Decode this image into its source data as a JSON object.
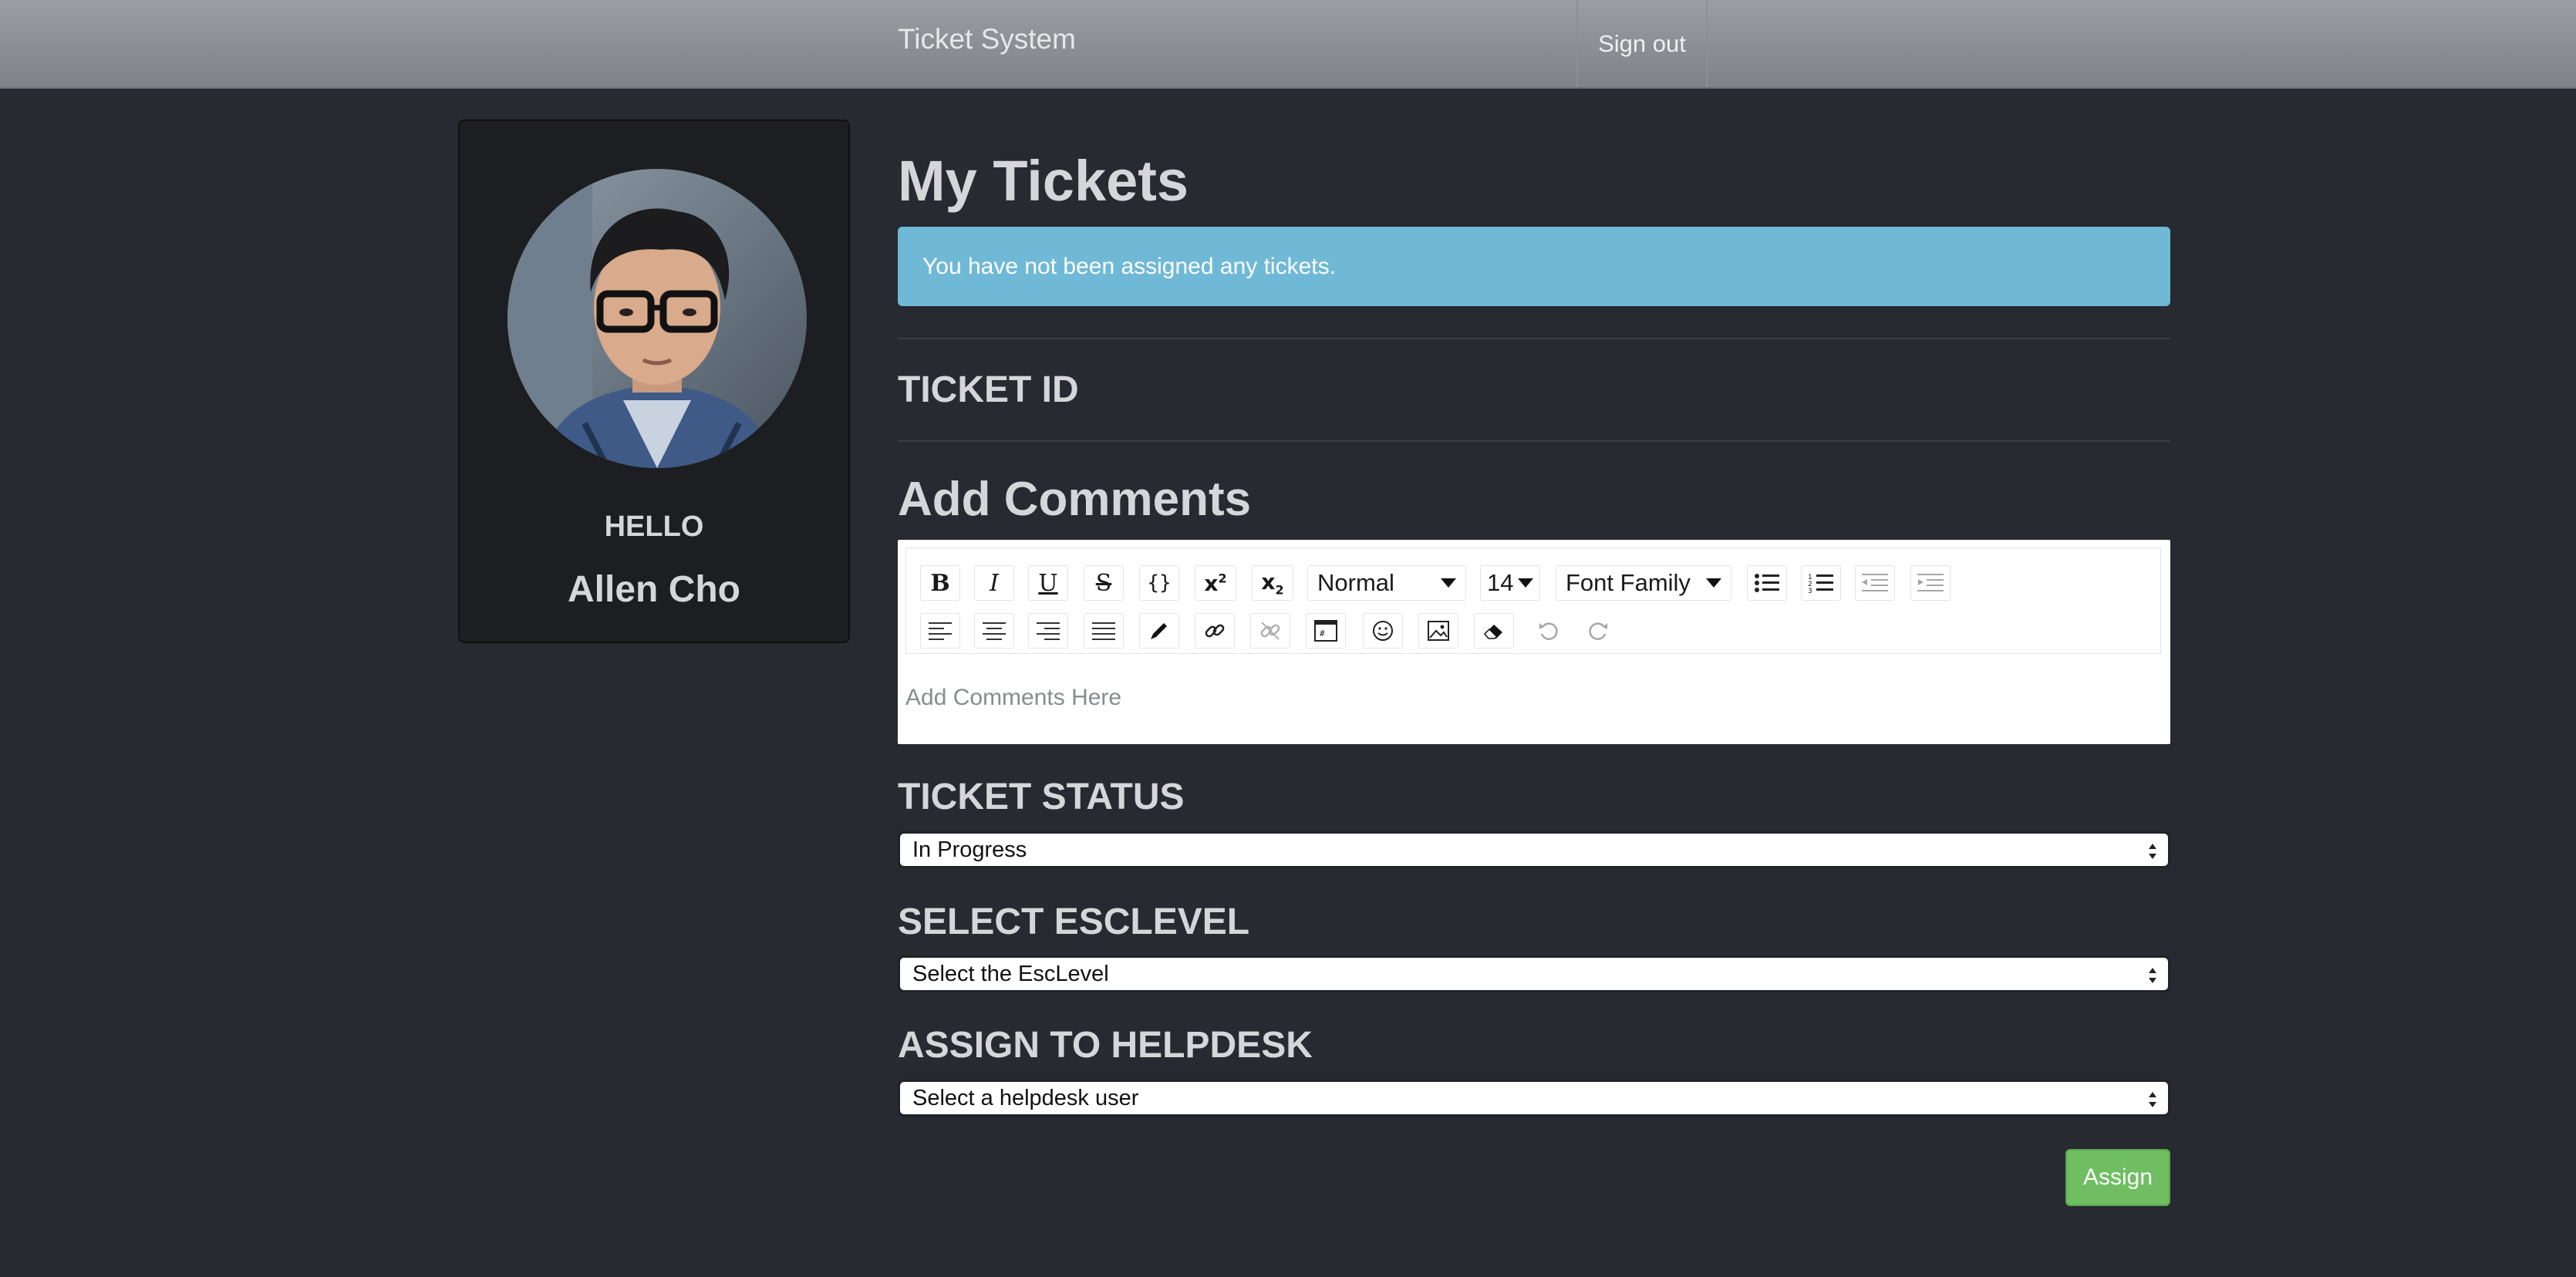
{
  "navbar": {
    "brand": "Ticket System",
    "signout_label": "Sign out"
  },
  "profile": {
    "greeting": "HELLO",
    "name": "Allen Cho"
  },
  "main": {
    "title": "My Tickets",
    "alert_text": "You have not been assigned any tickets.",
    "ticket_id_heading": "TICKET ID",
    "comments_heading": "Add Comments"
  },
  "editor": {
    "style_value": "Normal",
    "size_value": "14",
    "font_value": "Font Family",
    "placeholder": "Add Comments Here",
    "toolbar_row1": [
      "bold-icon",
      "italic-icon",
      "underline-icon",
      "strikethrough-icon",
      "code-icon",
      "superscript-icon",
      "subscript-icon",
      "style-dropdown",
      "font-size-dropdown",
      "font-family-dropdown",
      "unordered-list-icon",
      "ordered-list-icon",
      "outdent-icon",
      "indent-icon"
    ],
    "toolbar_row2": [
      "align-left-icon",
      "align-center-icon",
      "align-right-icon",
      "align-justify-icon",
      "color-picker-icon",
      "link-icon",
      "unlink-icon",
      "embedded-icon",
      "emoji-icon",
      "image-icon",
      "eraser-icon",
      "undo-icon",
      "redo-icon"
    ]
  },
  "ticket_status": {
    "heading": "TICKET STATUS",
    "selected": "In Progress"
  },
  "esc_level": {
    "heading": "SELECT ESCLEVEL",
    "selected": "Select the EscLevel"
  },
  "helpdesk": {
    "heading": "ASSIGN TO HELPDESK",
    "selected": "Select a helpdesk user"
  },
  "actions": {
    "assign_label": "Assign"
  },
  "colors": {
    "background": "#272a30",
    "alert": "#6fb9d6",
    "assign": "#6fbe62"
  }
}
